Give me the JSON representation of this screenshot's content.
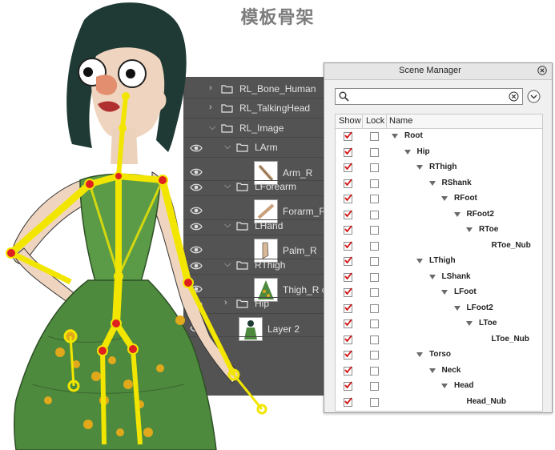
{
  "page": {
    "title": "模板骨架"
  },
  "layers": [
    {
      "label": "RL_Bone_Human",
      "type": "group",
      "level": 0,
      "expanded": false,
      "visible": false
    },
    {
      "label": "RL_TalkingHead",
      "type": "group",
      "level": 0,
      "expanded": false,
      "visible": false
    },
    {
      "label": "RL_Image",
      "type": "group",
      "level": 0,
      "expanded": true,
      "visible": false
    },
    {
      "label": "LArm",
      "type": "group",
      "level": 1,
      "expanded": true,
      "visible": true
    },
    {
      "label": "Arm_R",
      "type": "layer",
      "level": 2,
      "visible": true,
      "thumb": "arm"
    },
    {
      "label": "LForearm",
      "type": "group",
      "level": 1,
      "expanded": true,
      "visible": true
    },
    {
      "label": "Forarm_R",
      "type": "layer",
      "level": 2,
      "visible": true,
      "thumb": "forearm"
    },
    {
      "label": "LHand",
      "type": "group",
      "level": 1,
      "expanded": true,
      "visible": true
    },
    {
      "label": "Palm_R",
      "type": "layer",
      "level": 2,
      "visible": true,
      "thumb": "palm"
    },
    {
      "label": "RThigh",
      "type": "group",
      "level": 1,
      "expanded": true,
      "visible": true
    },
    {
      "label": "Thigh_R copy",
      "type": "layer",
      "level": 2,
      "visible": true,
      "thumb": "thigh"
    },
    {
      "label": "Hip",
      "type": "group",
      "level": 1,
      "expanded": false,
      "visible": true
    },
    {
      "label": "Layer 2",
      "type": "layer",
      "level": 1,
      "visible": true,
      "thumb": "character"
    }
  ],
  "scene_manager": {
    "title": "Scene Manager",
    "search": {
      "value": "",
      "placeholder": ""
    },
    "columns": {
      "show": "Show",
      "lock": "Lock",
      "name": "Name"
    },
    "tree": [
      {
        "label": "Root",
        "depth": 0,
        "expandable": true,
        "show": true,
        "lock": false
      },
      {
        "label": "Hip",
        "depth": 1,
        "expandable": true,
        "show": true,
        "lock": false
      },
      {
        "label": "RThigh",
        "depth": 2,
        "expandable": true,
        "show": true,
        "lock": false
      },
      {
        "label": "RShank",
        "depth": 3,
        "expandable": true,
        "show": true,
        "lock": false
      },
      {
        "label": "RFoot",
        "depth": 4,
        "expandable": true,
        "show": true,
        "lock": false
      },
      {
        "label": "RFoot2",
        "depth": 5,
        "expandable": true,
        "show": true,
        "lock": false
      },
      {
        "label": "RToe",
        "depth": 6,
        "expandable": true,
        "show": true,
        "lock": false
      },
      {
        "label": "RToe_Nub",
        "depth": 7,
        "expandable": false,
        "show": true,
        "lock": false
      },
      {
        "label": "LThigh",
        "depth": 2,
        "expandable": true,
        "show": true,
        "lock": false
      },
      {
        "label": "LShank",
        "depth": 3,
        "expandable": true,
        "show": true,
        "lock": false
      },
      {
        "label": "LFoot",
        "depth": 4,
        "expandable": true,
        "show": true,
        "lock": false
      },
      {
        "label": "LFoot2",
        "depth": 5,
        "expandable": true,
        "show": true,
        "lock": false
      },
      {
        "label": "LToe",
        "depth": 6,
        "expandable": true,
        "show": true,
        "lock": false
      },
      {
        "label": "LToe_Nub",
        "depth": 7,
        "expandable": false,
        "show": true,
        "lock": false
      },
      {
        "label": "Torso",
        "depth": 2,
        "expandable": true,
        "show": true,
        "lock": false
      },
      {
        "label": "Neck",
        "depth": 3,
        "expandable": true,
        "show": true,
        "lock": false
      },
      {
        "label": "Head",
        "depth": 4,
        "expandable": true,
        "show": true,
        "lock": false
      },
      {
        "label": "Head_Nub",
        "depth": 5,
        "expandable": false,
        "show": true,
        "lock": false
      },
      {
        "label": "",
        "depth": 2,
        "expandable": false,
        "show": true,
        "lock": false
      }
    ]
  },
  "colors": {
    "panel_bg": "#535353",
    "bone_yellow": "#f2e600",
    "joint_red": "#e02020",
    "dress_green": "#4e8a3e",
    "hair": "#1f3a34",
    "check_red": "#d01010"
  }
}
